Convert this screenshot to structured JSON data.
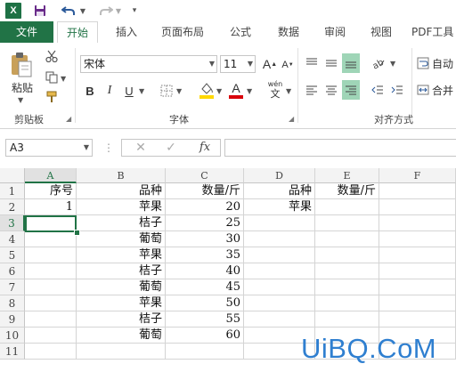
{
  "ribbon_tabs": [
    "文件",
    "开始",
    "插入",
    "页面布局",
    "公式",
    "数据",
    "审阅",
    "视图",
    "PDF工具"
  ],
  "ribbon": {
    "clipboard": {
      "paste_label": "粘贴",
      "group_label": "剪贴板"
    },
    "font": {
      "font_name": "宋体",
      "font_size": "11",
      "group_label": "字体",
      "bold": "B",
      "italic": "I",
      "underline": "U",
      "grow": "A",
      "shrink": "A",
      "font_color_glyph": "A",
      "phonetic": "wén",
      "phonetic_sub": "文"
    },
    "alignment": {
      "group_label": "对齐方式",
      "wrap_text": "自动",
      "merge": "合并"
    }
  },
  "formula_bar": {
    "name_box": "A3",
    "fx": "fx",
    "formula": ""
  },
  "sheet": {
    "columns": [
      "A",
      "B",
      "C",
      "D",
      "E",
      "F"
    ],
    "selected_column": "A",
    "rows": [
      "1",
      "2",
      "3",
      "4",
      "5",
      "6",
      "7",
      "8",
      "9",
      "10",
      "11"
    ],
    "selected_row": "3",
    "headers_row1": {
      "A": "序号",
      "B": "品种",
      "C": "数量/斤",
      "D": "品种",
      "E": "数量/斤"
    },
    "A2": "1",
    "D2": "苹果",
    "data": [
      {
        "fruit": "苹果",
        "qty": "20"
      },
      {
        "fruit": "桔子",
        "qty": "25"
      },
      {
        "fruit": "葡萄",
        "qty": "30"
      },
      {
        "fruit": "苹果",
        "qty": "35"
      },
      {
        "fruit": "桔子",
        "qty": "40"
      },
      {
        "fruit": "葡萄",
        "qty": "45"
      },
      {
        "fruit": "苹果",
        "qty": "50"
      },
      {
        "fruit": "桔子",
        "qty": "55"
      },
      {
        "fruit": "葡萄",
        "qty": "60"
      }
    ],
    "active_cell": "A3"
  },
  "watermark": "UiBQ.CoM",
  "colors": {
    "excel_green": "#217346",
    "highlight": "#9fd5b7",
    "fill_yellow": "#ffd800",
    "font_red": "#d9000a"
  }
}
